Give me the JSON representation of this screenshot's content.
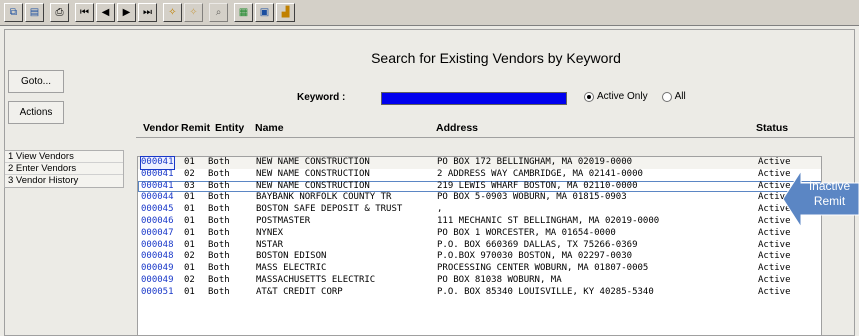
{
  "toolbar": {
    "icons": [
      "copy-icon",
      "paste-icon",
      "print-icon",
      "first-record-icon",
      "previous-record-icon",
      "next-record-icon",
      "last-record-icon",
      "wizard-icon",
      "wizard-disabled-icon",
      "find-icon",
      "spreadsheet-icon",
      "properties-icon",
      "chart-icon"
    ]
  },
  "page": {
    "title": "Search for Existing Vendors by Keyword"
  },
  "side": {
    "goto_label": "Goto...",
    "actions_label": "Actions",
    "links": [
      "1 View Vendors",
      "2 Enter Vendors",
      "3 Vendor History"
    ]
  },
  "search": {
    "keyword_label": "Keyword :",
    "keyword_value": "",
    "radio_active_label": "Active Only",
    "radio_all_label": "All",
    "selected": "Active Only"
  },
  "grid": {
    "headers": {
      "vendor": "Vendor",
      "remit": "Remit",
      "entity": "Entity",
      "name": "Name",
      "address": "Address",
      "status": "Status"
    },
    "rows": [
      {
        "vendor": "000041",
        "remit": "01",
        "entity": "Both",
        "name": "NEW NAME CONSTRUCTION",
        "address": "PO BOX 172 BELLINGHAM, MA 02019-0000",
        "status": "Active"
      },
      {
        "vendor": "000041",
        "remit": "02",
        "entity": "Both",
        "name": "NEW NAME CONSTRUCTION",
        "address": "2 ADDRESS WAY CAMBRIDGE, MA 02141-0000",
        "status": "Active"
      },
      {
        "vendor": "000041",
        "remit": "03",
        "entity": "Both",
        "name": "NEW NAME CONSTRUCTION",
        "address": "219 LEWIS WHARF BOSTON, MA 02110-0000",
        "status": "Active"
      },
      {
        "vendor": "000044",
        "remit": "01",
        "entity": "Both",
        "name": "BAYBANK NORFOLK COUNTY TR",
        "address": "PO BOX 5-0903 WOBURN, MA 01815-0903",
        "status": "Active"
      },
      {
        "vendor": "000045",
        "remit": "01",
        "entity": "Both",
        "name": "BOSTON SAFE DEPOSIT & TRUST",
        "address": ",",
        "status": "Active"
      },
      {
        "vendor": "000046",
        "remit": "01",
        "entity": "Both",
        "name": "POSTMASTER",
        "address": "111 MECHANIC ST BELLINGHAM, MA 02019-0000",
        "status": "Active"
      },
      {
        "vendor": "000047",
        "remit": "01",
        "entity": "Both",
        "name": "NYNEX",
        "address": "PO BOX 1 WORCESTER, MA 01654-0000",
        "status": "Active"
      },
      {
        "vendor": "000048",
        "remit": "01",
        "entity": "Both",
        "name": "NSTAR",
        "address": "P.O. BOX 660369 DALLAS, TX 75266-0369",
        "status": "Active"
      },
      {
        "vendor": "000048",
        "remit": "02",
        "entity": "Both",
        "name": "BOSTON EDISON",
        "address": "P.O.BOX 970030 BOSTON, MA 02297-0030",
        "status": "Active"
      },
      {
        "vendor": "000049",
        "remit": "01",
        "entity": "Both",
        "name": "MASS ELECTRIC",
        "address": "PROCESSING CENTER WOBURN, MA 01807-0005",
        "status": "Active"
      },
      {
        "vendor": "000049",
        "remit": "02",
        "entity": "Both",
        "name": "MASSACHUSETTS ELECTRIC",
        "address": "PO BOX 81038 WOBURN, MA",
        "status": "Active"
      },
      {
        "vendor": "000051",
        "remit": "01",
        "entity": "Both",
        "name": "AT&T CREDIT CORP",
        "address": "P.O. BOX 85340 LOUISVILLE, KY 40285-5340",
        "status": "Active"
      }
    ]
  },
  "callout": {
    "text": "Inactive Remit",
    "color": "#5b86c4"
  }
}
